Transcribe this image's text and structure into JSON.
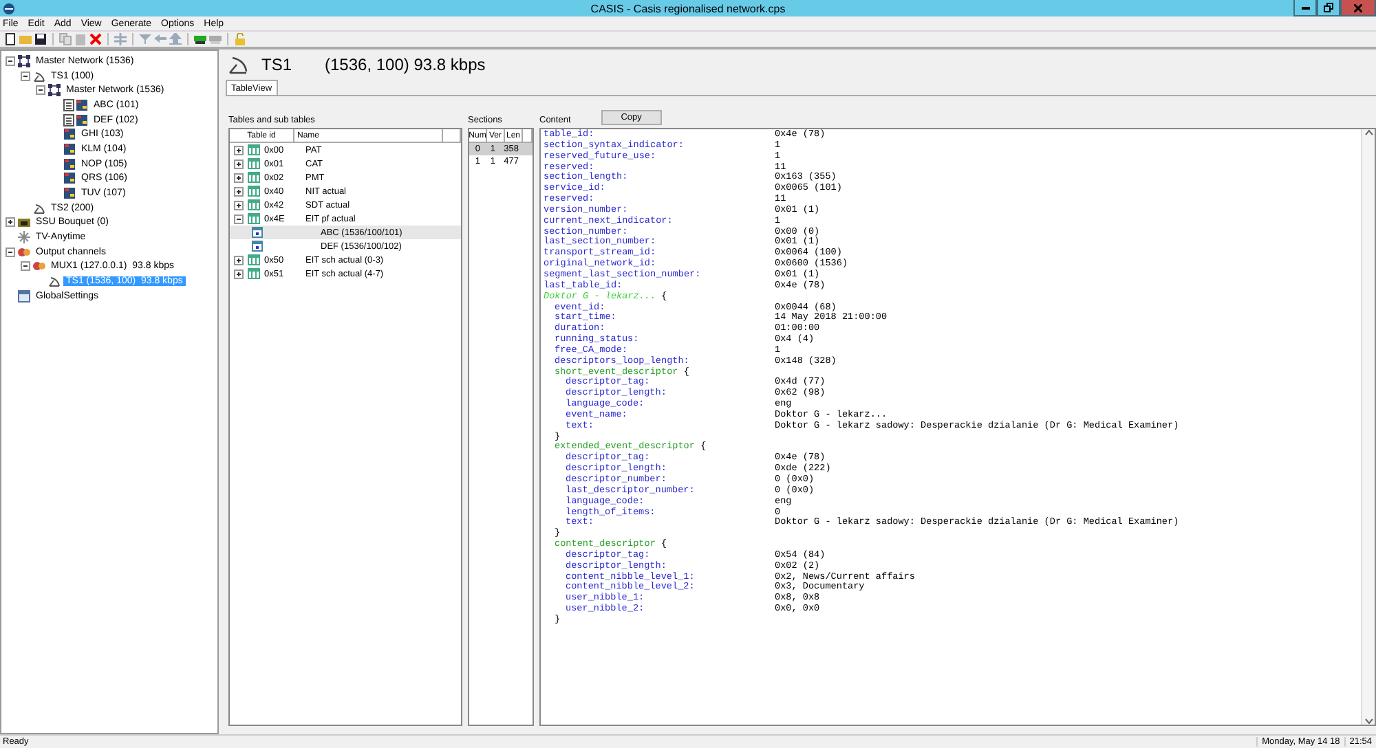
{
  "window": {
    "title": "CASIS - Casis regionalised network.cps"
  },
  "menu": [
    "File",
    "Edit",
    "Add",
    "View",
    "Generate",
    "Options",
    "Help"
  ],
  "tree": [
    {
      "label": "Master Network (1536)",
      "kind": "network",
      "expanded": true,
      "selected": false,
      "children": [
        {
          "label": "TS1 (100)",
          "kind": "stream",
          "expanded": true,
          "selected": false,
          "children": [
            {
              "label": "Master Network (1536)",
              "kind": "network",
              "expanded": true,
              "selected": false,
              "children": [
                {
                  "label": "ABC (101)",
                  "kind": "service_doc",
                  "selected": false
                },
                {
                  "label": "DEF (102)",
                  "kind": "service_doc",
                  "selected": false
                },
                {
                  "label": "GHI (103)",
                  "kind": "service",
                  "selected": false
                },
                {
                  "label": "KLM (104)",
                  "kind": "service",
                  "selected": false
                },
                {
                  "label": "NOP (105)",
                  "kind": "service",
                  "selected": false
                },
                {
                  "label": "QRS (106)",
                  "kind": "service",
                  "selected": false
                },
                {
                  "label": "TUV (107)",
                  "kind": "service",
                  "selected": false
                }
              ]
            }
          ]
        },
        {
          "label": "TS2 (200)",
          "kind": "stream",
          "selected": false
        }
      ]
    },
    {
      "label": "SSU Bouquet (0)",
      "kind": "bouquet",
      "expanded": false,
      "selected": false
    },
    {
      "label": "TV-Anytime",
      "kind": "anytime",
      "selected": false
    },
    {
      "label": "Output channels",
      "kind": "output",
      "expanded": true,
      "selected": false,
      "children": [
        {
          "label": "MUX1 (127.0.0.1)  93.8 kbps",
          "kind": "mux",
          "expanded": true,
          "selected": false,
          "children": [
            {
              "label": "TS1 (1536, 100)  93.8 kbps",
              "kind": "stream",
              "selected": true
            }
          ]
        }
      ]
    },
    {
      "label": "GlobalSettings",
      "kind": "settings",
      "selected": false
    }
  ],
  "header": {
    "title": "TS1",
    "detail": "(1536, 100)  93.8 kbps"
  },
  "tabs": [
    {
      "label": "TableView",
      "selected": true
    }
  ],
  "tables": {
    "label": "Tables and sub tables",
    "columns": [
      "Table id",
      "Name"
    ],
    "rows": [
      {
        "id": "0x00",
        "name": "PAT",
        "expanded": false,
        "selected": false
      },
      {
        "id": "0x01",
        "name": "CAT",
        "expanded": false,
        "selected": false
      },
      {
        "id": "0x02",
        "name": "PMT",
        "expanded": false,
        "selected": false
      },
      {
        "id": "0x40",
        "name": "NIT actual",
        "expanded": false,
        "selected": false
      },
      {
        "id": "0x42",
        "name": "SDT actual",
        "expanded": false,
        "selected": false
      },
      {
        "id": "0x4E",
        "name": "EIT pf actual",
        "expanded": true,
        "selected": false,
        "children": [
          {
            "name": "ABC (1536/100/101)",
            "selected": true
          },
          {
            "name": "DEF (1536/100/102)",
            "selected": false
          }
        ]
      },
      {
        "id": "0x50",
        "name": "EIT sch actual (0-3)",
        "expanded": false,
        "selected": false
      },
      {
        "id": "0x51",
        "name": "EIT sch actual (4-7)",
        "expanded": false,
        "selected": false
      }
    ]
  },
  "sections": {
    "label": "Sections",
    "columns": [
      "Num",
      "Ver",
      "Len"
    ],
    "rows": [
      {
        "cells": [
          "0",
          "1",
          "358"
        ],
        "selected": true
      },
      {
        "cells": [
          "1",
          "1",
          "477"
        ],
        "selected": false
      }
    ]
  },
  "content": {
    "label": "Content",
    "copy_button": "Copy",
    "lines": [
      {
        "kind": "field",
        "key": "table_id:",
        "value": "0x4e (78)"
      },
      {
        "kind": "field",
        "key": "section_syntax_indicator:",
        "value": "1"
      },
      {
        "kind": "field",
        "key": "reserved_future_use:",
        "value": "1"
      },
      {
        "kind": "field",
        "key": "reserved:",
        "value": "11"
      },
      {
        "kind": "field",
        "key": "section_length:",
        "value": "0x163 (355)"
      },
      {
        "kind": "field",
        "key": "service_id:",
        "value": "0x0065 (101)"
      },
      {
        "kind": "field",
        "key": "reserved:",
        "value": "11"
      },
      {
        "kind": "field",
        "key": "version_number:",
        "value": "0x01 (1)"
      },
      {
        "kind": "field",
        "key": "current_next_indicator:",
        "value": "1"
      },
      {
        "kind": "field",
        "key": "section_number:",
        "value": "0x00 (0)"
      },
      {
        "kind": "field",
        "key": "last_section_number:",
        "value": "0x01 (1)"
      },
      {
        "kind": "field",
        "key": "transport_stream_id:",
        "value": "0x0064 (100)"
      },
      {
        "kind": "field",
        "key": "original_network_id:",
        "value": "0x0600 (1536)"
      },
      {
        "kind": "field",
        "key": "segment_last_section_number:",
        "value": "0x01 (1)"
      },
      {
        "kind": "field",
        "key": "last_table_id:",
        "value": "0x4e (78)"
      },
      {
        "kind": "event",
        "title": "Doktor G - lekarz...",
        "open": "{",
        "children": [
          {
            "kind": "field",
            "key": "event_id:",
            "value": "0x0044 (68)"
          },
          {
            "kind": "field",
            "key": "start_time:",
            "value": "14 May 2018 21:00:00"
          },
          {
            "kind": "field",
            "key": "duration:",
            "value": "01:00:00"
          },
          {
            "kind": "field",
            "key": "running_status:",
            "value": "0x4 (4)"
          },
          {
            "kind": "field",
            "key": "free_CA_mode:",
            "value": "1"
          },
          {
            "kind": "field",
            "key": "descriptors_loop_length:",
            "value": "0x148 (328)"
          },
          {
            "kind": "group",
            "title": "short_event_descriptor",
            "open": "{",
            "close": "}",
            "children": [
              {
                "kind": "field",
                "key": "descriptor_tag:",
                "value": "0x4d (77)"
              },
              {
                "kind": "field",
                "key": "descriptor_length:",
                "value": "0x62 (98)"
              },
              {
                "kind": "field",
                "key": "language_code:",
                "value": "eng"
              },
              {
                "kind": "field",
                "key": "event_name:",
                "value": "Doktor G - lekarz..."
              },
              {
                "kind": "field",
                "key": "text:",
                "value": "Doktor G - lekarz sadowy: Desperackie dzialanie (Dr G: Medical Examiner)"
              }
            ]
          },
          {
            "kind": "group",
            "title": "extended_event_descriptor",
            "open": "{",
            "close": "}",
            "children": [
              {
                "kind": "field",
                "key": "descriptor_tag:",
                "value": "0x4e (78)"
              },
              {
                "kind": "field",
                "key": "descriptor_length:",
                "value": "0xde (222)"
              },
              {
                "kind": "field",
                "key": "descriptor_number:",
                "value": "0 (0x0)"
              },
              {
                "kind": "field",
                "key": "last_descriptor_number:",
                "value": "0 (0x0)"
              },
              {
                "kind": "field",
                "key": "language_code:",
                "value": "eng"
              },
              {
                "kind": "field",
                "key": "length_of_items:",
                "value": "0"
              },
              {
                "kind": "field",
                "key": "text:",
                "value": "Doktor G - lekarz sadowy: Desperackie dzialanie (Dr G: Medical Examiner)"
              }
            ]
          },
          {
            "kind": "group",
            "title": "content_descriptor",
            "open": "{",
            "close": "}",
            "children": [
              {
                "kind": "field",
                "key": "descriptor_tag:",
                "value": "0x54 (84)"
              },
              {
                "kind": "field",
                "key": "descriptor_length:",
                "value": "0x02 (2)"
              },
              {
                "kind": "field",
                "key": "content_nibble_level_1:",
                "value": "0x2, News/Current affairs"
              },
              {
                "kind": "field",
                "key": "content_nibble_level_2:",
                "value": "0x3, Documentary"
              },
              {
                "kind": "field",
                "key": "user_nibble_1:",
                "value": "0x8, 0x8"
              },
              {
                "kind": "field",
                "key": "user_nibble_2:",
                "value": "0x0, 0x0"
              }
            ]
          }
        ]
      }
    ]
  },
  "status_bar": {
    "message": "Ready",
    "date": "Monday, May 14 18",
    "time": "21:54"
  }
}
